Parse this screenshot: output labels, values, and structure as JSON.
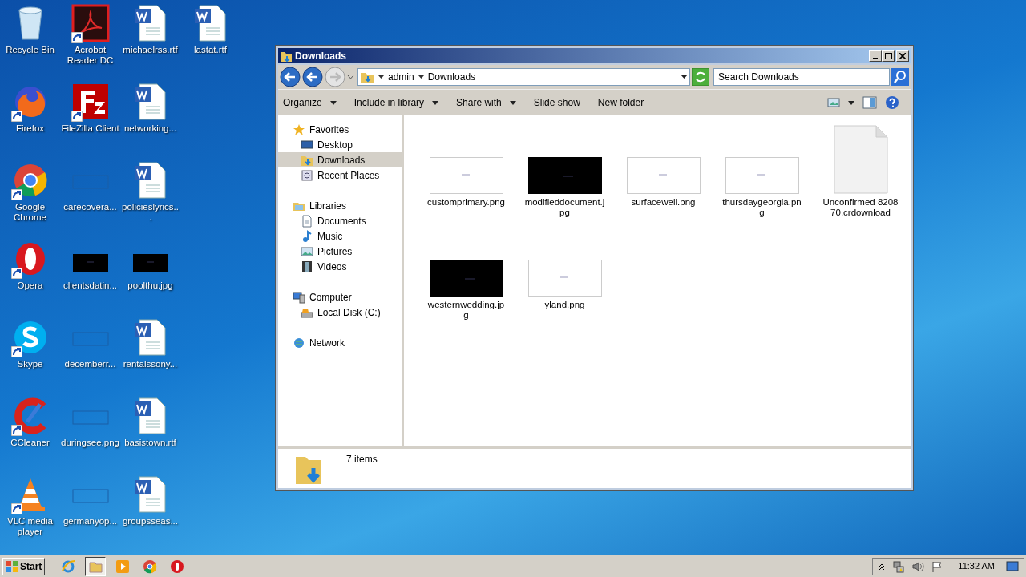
{
  "desktop": {
    "columns": [
      [
        {
          "label": "Recycle Bin",
          "kind": "recycle-bin",
          "shortcut": false
        },
        {
          "label": "Firefox",
          "kind": "firefox",
          "shortcut": true
        },
        {
          "label": "Google Chrome",
          "kind": "chrome",
          "shortcut": true
        },
        {
          "label": "Opera",
          "kind": "opera",
          "shortcut": true
        },
        {
          "label": "Skype",
          "kind": "skype",
          "shortcut": true
        },
        {
          "label": "CCleaner",
          "kind": "ccleaner",
          "shortcut": true
        },
        {
          "label": "VLC media player",
          "kind": "vlc",
          "shortcut": true
        }
      ],
      [
        {
          "label": "Acrobat Reader DC",
          "kind": "acrobat",
          "shortcut": true
        },
        {
          "label": "FileZilla Client",
          "kind": "filezilla",
          "shortcut": true
        },
        {
          "label": "carecovera...",
          "kind": "image-clear",
          "shortcut": false
        },
        {
          "label": "clientsdatin...",
          "kind": "image-black",
          "shortcut": false
        },
        {
          "label": "decemberr...",
          "kind": "image-clear",
          "shortcut": false
        },
        {
          "label": "duringsee.png",
          "kind": "image-clear",
          "shortcut": false
        },
        {
          "label": "germanyop...",
          "kind": "image-clear",
          "shortcut": false
        }
      ],
      [
        {
          "label": "michaelrss.rtf",
          "kind": "word-doc",
          "shortcut": false
        },
        {
          "label": "networking...",
          "kind": "word-doc",
          "shortcut": false
        },
        {
          "label": "policieslyrics...",
          "kind": "word-doc",
          "shortcut": false
        },
        {
          "label": "poolthu.jpg",
          "kind": "image-black",
          "shortcut": false
        },
        {
          "label": "rentalssony...",
          "kind": "word-doc",
          "shortcut": false
        },
        {
          "label": "basistown.rtf",
          "kind": "word-doc",
          "shortcut": false
        },
        {
          "label": "groupsseas...",
          "kind": "word-doc",
          "shortcut": false
        }
      ],
      [
        {
          "label": "lastat.rtf",
          "kind": "word-doc",
          "shortcut": false
        }
      ]
    ]
  },
  "window": {
    "title": "Downloads",
    "address": {
      "breadcrumbs": [
        "admin",
        "Downloads"
      ]
    },
    "search": {
      "placeholder": "Search Downloads"
    },
    "toolbar": [
      {
        "label": "Organize",
        "dropdown": true
      },
      {
        "label": "Include in library",
        "dropdown": true
      },
      {
        "label": "Share with",
        "dropdown": true
      },
      {
        "label": "Slide show",
        "dropdown": false
      },
      {
        "label": "New folder",
        "dropdown": false
      }
    ],
    "nav": [
      {
        "label": "Favorites",
        "kind": "star",
        "selected": false,
        "children": [
          {
            "label": "Desktop",
            "kind": "desktop",
            "selected": false
          },
          {
            "label": "Downloads",
            "kind": "downloads",
            "selected": true
          },
          {
            "label": "Recent Places",
            "kind": "recent",
            "selected": false
          }
        ]
      },
      {
        "label": "Libraries",
        "kind": "libraries",
        "selected": false,
        "children": [
          {
            "label": "Documents",
            "kind": "documents",
            "selected": false
          },
          {
            "label": "Music",
            "kind": "music",
            "selected": false
          },
          {
            "label": "Pictures",
            "kind": "pictures",
            "selected": false
          },
          {
            "label": "Videos",
            "kind": "videos",
            "selected": false
          }
        ]
      },
      {
        "label": "Computer",
        "kind": "computer",
        "selected": false,
        "children": [
          {
            "label": "Local Disk (C:)",
            "kind": "disk",
            "selected": false
          }
        ]
      },
      {
        "label": "Network",
        "kind": "network",
        "selected": false
      }
    ],
    "files": [
      {
        "label": "customprimary.png",
        "kind": "image-white"
      },
      {
        "label": "modifieddocument.jpg",
        "kind": "image-black"
      },
      {
        "label": "surfacewell.png",
        "kind": "image-white"
      },
      {
        "label": "thursdaygeorgia.png",
        "kind": "image-white"
      },
      {
        "label": "Unconfirmed 820870.crdownload",
        "kind": "blank-file"
      },
      {
        "label": "westernwedding.jpg",
        "kind": "image-black"
      },
      {
        "label": "yland.png",
        "kind": "image-white"
      }
    ],
    "status": "7 items"
  },
  "taskbar": {
    "start": "Start",
    "apps": [
      {
        "kind": "ie",
        "selected": false
      },
      {
        "kind": "explorer",
        "selected": true
      },
      {
        "kind": "media",
        "selected": false
      },
      {
        "kind": "chrome",
        "selected": false
      },
      {
        "kind": "opera",
        "selected": false
      }
    ],
    "clock": "11:32 AM"
  }
}
